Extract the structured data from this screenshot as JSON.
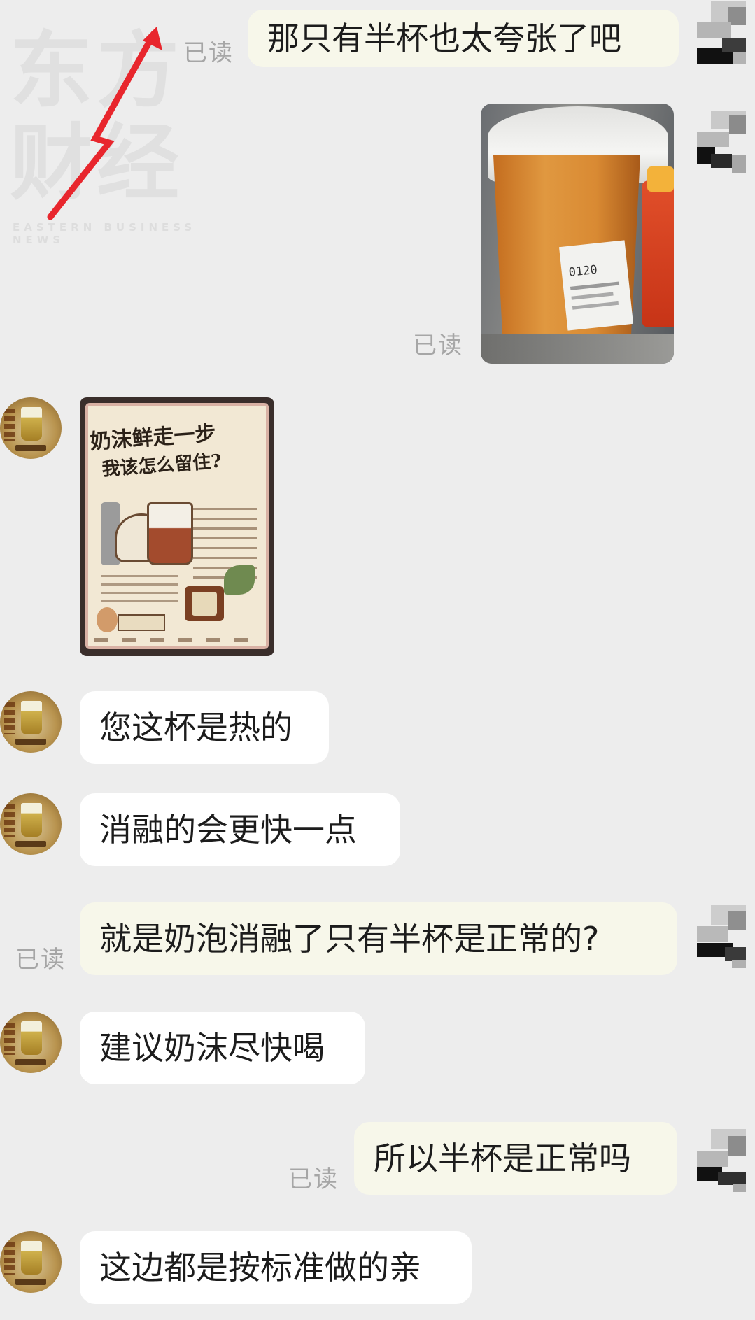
{
  "watermark": {
    "line1": "东方",
    "line2": "财经",
    "sub": "EASTERN BUSINESS NEWS"
  },
  "read_label": "已读",
  "messages": [
    {
      "side": "right",
      "type": "text",
      "text": "那只有半杯也太夸张了吧",
      "read": "已读"
    },
    {
      "side": "right",
      "type": "image",
      "content": "photo-cup",
      "read": "已读"
    },
    {
      "side": "left",
      "type": "image",
      "content": "photo-poster"
    },
    {
      "side": "left",
      "type": "text",
      "text": "您这杯是热的"
    },
    {
      "side": "left",
      "type": "text",
      "text": "消融的会更快一点"
    },
    {
      "side": "right",
      "type": "text",
      "text": "就是奶泡消融了只有半杯是正常的?",
      "read": "已读"
    },
    {
      "side": "left",
      "type": "text",
      "text": "建议奶沫尽快喝"
    },
    {
      "side": "right",
      "type": "text",
      "text": "所以半杯是正常吗",
      "read": "已读"
    },
    {
      "side": "left",
      "type": "text",
      "text": "这边都是按标准做的亲"
    }
  ],
  "photo_cup": {
    "label_text": "0120"
  },
  "poster": {
    "headline_1": "奶沫鲜走一步",
    "headline_2": "我该怎么留住?"
  },
  "colors": {
    "background": "#ededed",
    "right_bubble": "#f7f7ea",
    "left_bubble": "#ffffff",
    "read_text": "#a6a6a6",
    "arrow": "#e8262d"
  }
}
